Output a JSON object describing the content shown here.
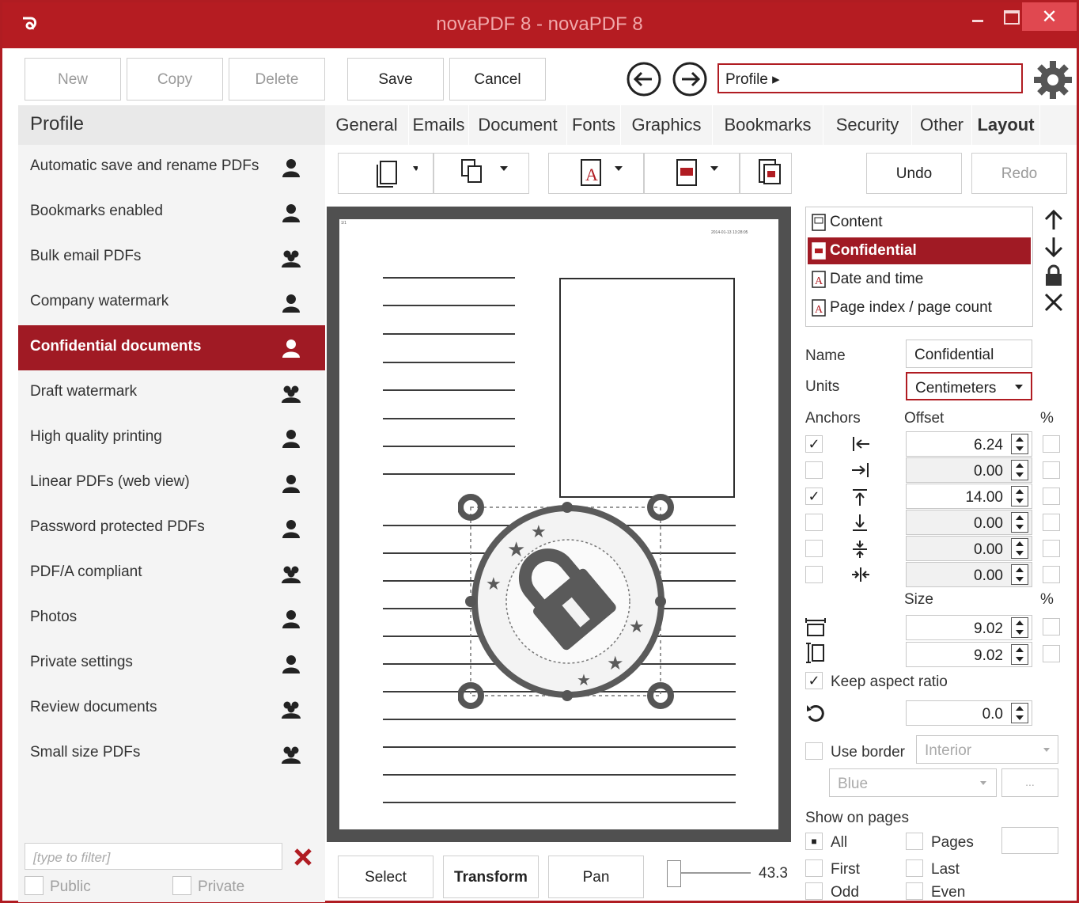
{
  "window": {
    "title": "novaPDF 8 - novaPDF 8"
  },
  "toolbar": {
    "new": "New",
    "copy": "Copy",
    "delete": "Delete",
    "save": "Save",
    "cancel": "Cancel",
    "breadcrumb": "Profile ▸"
  },
  "profiles": {
    "header": "Profile",
    "items": [
      {
        "label": "Automatic save and rename PDFs",
        "icon": "single-user-icon"
      },
      {
        "label": "Bookmarks enabled",
        "icon": "single-user-icon"
      },
      {
        "label": "Bulk email PDFs",
        "icon": "group-users-icon"
      },
      {
        "label": "Company watermark",
        "icon": "single-user-icon"
      },
      {
        "label": "Confidential documents",
        "icon": "single-user-icon",
        "selected": true
      },
      {
        "label": "Draft watermark",
        "icon": "group-users-icon"
      },
      {
        "label": "High quality printing",
        "icon": "single-user-icon"
      },
      {
        "label": "Linear PDFs (web view)",
        "icon": "single-user-icon"
      },
      {
        "label": "Password protected PDFs",
        "icon": "single-user-icon"
      },
      {
        "label": "PDF/A compliant",
        "icon": "group-users-icon"
      },
      {
        "label": "Photos",
        "icon": "single-user-icon"
      },
      {
        "label": "Private settings",
        "icon": "single-user-icon"
      },
      {
        "label": "Review documents",
        "icon": "group-users-icon"
      },
      {
        "label": "Small size PDFs",
        "icon": "group-users-icon"
      }
    ],
    "filter_placeholder": "[type to filter]",
    "public": "Public",
    "private": "Private"
  },
  "tabs": [
    "General",
    "Emails",
    "Document",
    "Fonts",
    "Graphics",
    "Bookmarks",
    "Security",
    "Other",
    "Layout"
  ],
  "active_tab": "Layout",
  "layout_toolbar": {
    "undo": "Undo",
    "redo": "Redo"
  },
  "preview": {
    "page_number": "1/1",
    "datetime": "2014-01-13 13:28:05",
    "select": "Select",
    "transform": "Transform",
    "pan": "Pan",
    "zoom": "43.3"
  },
  "layers": [
    {
      "label": "Content",
      "icon": "content-icon"
    },
    {
      "label": "Confidential",
      "icon": "image-watermark-icon",
      "selected": true
    },
    {
      "label": "Date and time",
      "icon": "text-watermark-icon"
    },
    {
      "label": "Page index / page count",
      "icon": "text-watermark-icon"
    }
  ],
  "properties": {
    "name_label": "Name",
    "name_value": "Confidential",
    "units_label": "Units",
    "units_value": "Centimeters",
    "anchors_label": "Anchors",
    "offset_label": "Offset",
    "percent": "%",
    "offsets": [
      {
        "checked": true,
        "value": "6.24",
        "icon": "anchor-left-icon"
      },
      {
        "checked": false,
        "value": "0.00",
        "icon": "anchor-right-icon"
      },
      {
        "checked": true,
        "value": "14.00",
        "icon": "anchor-top-icon"
      },
      {
        "checked": false,
        "value": "0.00",
        "icon": "anchor-bottom-icon"
      },
      {
        "checked": false,
        "value": "0.00",
        "icon": "anchor-vcenter-icon"
      },
      {
        "checked": false,
        "value": "0.00",
        "icon": "anchor-hcenter-icon"
      }
    ],
    "size_label": "Size",
    "width": "9.02",
    "height": "9.02",
    "keep_aspect": "Keep aspect ratio",
    "rotation": "0.0",
    "use_border": "Use border",
    "border_type": "Interior",
    "border_color": "Blue",
    "ellipsis": "...",
    "show_on_pages": "Show on pages",
    "all": "All",
    "pages": "Pages",
    "first": "First",
    "last": "Last",
    "odd": "Odd",
    "even": "Even"
  },
  "colors": {
    "accent": "#a01a24",
    "titlebar": "#b51c22"
  }
}
